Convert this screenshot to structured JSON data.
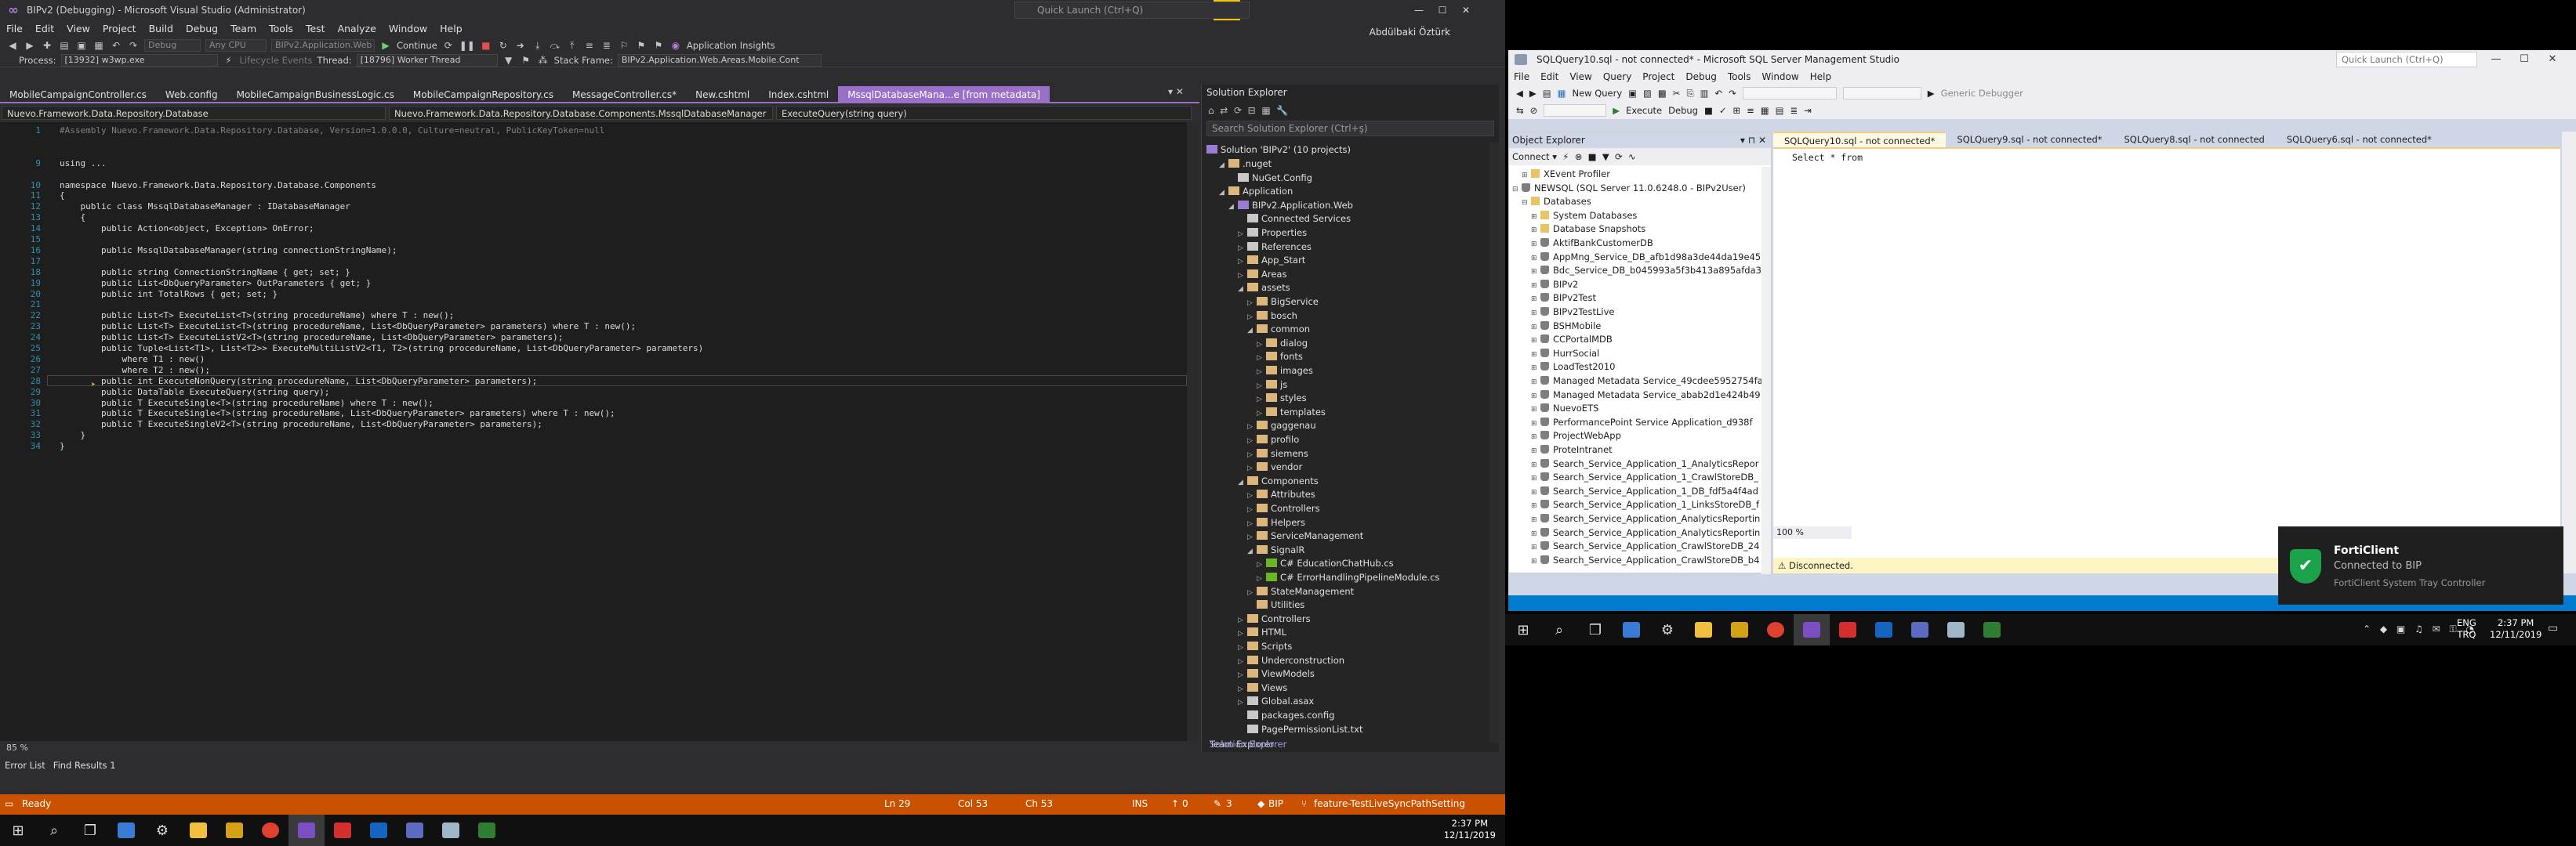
{
  "vs": {
    "title": "BIPv2 (Debugging) - Microsoft Visual Studio (Administrator)",
    "menu": [
      "File",
      "Edit",
      "View",
      "Project",
      "Build",
      "Debug",
      "Team",
      "Tools",
      "Test",
      "Analyze",
      "Window",
      "Help"
    ],
    "quick_launch": "Quick Launch (Ctrl+Q)",
    "user": "Abdülbaki Öztürk",
    "toolbar": {
      "debug_combo": "Debug",
      "cpu_combo": "Any CPU",
      "project_combo": "BIPv2.Application.Web",
      "continue": "Continue",
      "app_insights": "Application Insights",
      "process_label": "Process:",
      "process_value": "[13932] w3wp.exe",
      "lifecycle": "Lifecycle Events",
      "thread_label": "Thread:",
      "thread_value": "[18796] Worker Thread",
      "stack_label": "Stack Frame:",
      "stack_value": "BIPv2.Application.Web.Areas.Mobile.Cont"
    },
    "doc_tabs": [
      {
        "label": "MobileCampaignController.cs",
        "active": false
      },
      {
        "label": "Web.config",
        "active": false
      },
      {
        "label": "MobileCampaignBusinessLogic.cs",
        "active": false
      },
      {
        "label": "MobileCampaignRepository.cs",
        "active": false
      },
      {
        "label": "MessageController.cs*",
        "active": false
      },
      {
        "label": "New.cshtml",
        "active": false
      },
      {
        "label": "Index.cshtml",
        "active": false
      },
      {
        "label": "MssqlDatabaseMana...e [from metadata]",
        "active": true
      }
    ],
    "nav": {
      "left": "Nuevo.Framework.Data.Repository.Database",
      "middle": "Nuevo.Framework.Data.Repository.Database.Components.MssqlDatabaseManager",
      "right": "ExecuteQuery(string query)"
    },
    "code_lines": [
      {
        "n": "1",
        "t": "#Assembly Nuevo.Framework.Data.Repository.Database, Version=1.0.0.0, Culture=neutral, PublicKeyToken=null",
        "cls": "cm"
      },
      {
        "n": "",
        "t": "",
        "cls": ""
      },
      {
        "n": "",
        "t": "",
        "cls": ""
      },
      {
        "n": "9",
        "t": "using ...",
        "cls": ""
      },
      {
        "n": "",
        "t": "",
        "cls": ""
      },
      {
        "n": "10",
        "t": "namespace Nuevo.Framework.Data.Repository.Database.Components",
        "cls": ""
      },
      {
        "n": "11",
        "t": "{",
        "cls": ""
      },
      {
        "n": "12",
        "t": "    public class MssqlDatabaseManager : IDatabaseManager",
        "cls": ""
      },
      {
        "n": "13",
        "t": "    {",
        "cls": ""
      },
      {
        "n": "14",
        "t": "        public Action<object, Exception> OnError;",
        "cls": ""
      },
      {
        "n": "15",
        "t": "",
        "cls": ""
      },
      {
        "n": "16",
        "t": "        public MssqlDatabaseManager(string connectionStringName);",
        "cls": ""
      },
      {
        "n": "17",
        "t": "",
        "cls": ""
      },
      {
        "n": "18",
        "t": "        public string ConnectionStringName { get; set; }",
        "cls": ""
      },
      {
        "n": "19",
        "t": "        public List<DbQueryParameter> OutParameters { get; }",
        "cls": ""
      },
      {
        "n": "20",
        "t": "        public int TotalRows { get; set; }",
        "cls": ""
      },
      {
        "n": "21",
        "t": "",
        "cls": ""
      },
      {
        "n": "22",
        "t": "        public List<T> ExecuteList<T>(string procedureName) where T : new();",
        "cls": ""
      },
      {
        "n": "23",
        "t": "        public List<T> ExecuteList<T>(string procedureName, List<DbQueryParameter> parameters) where T : new();",
        "cls": ""
      },
      {
        "n": "24",
        "t": "        public List<T> ExecuteListV2<T>(string procedureName, List<DbQueryParameter> parameters);",
        "cls": ""
      },
      {
        "n": "25",
        "t": "        public Tuple<List<T1>, List<T2>> ExecuteMultiListV2<T1, T2>(string procedureName, List<DbQueryParameter> parameters)",
        "cls": ""
      },
      {
        "n": "26",
        "t": "            where T1 : new()",
        "cls": ""
      },
      {
        "n": "27",
        "t": "            where T2 : new();",
        "cls": ""
      },
      {
        "n": "28",
        "t": "        public int ExecuteNonQuery(string procedureName, List<DbQueryParameter> parameters);",
        "cls": ""
      },
      {
        "n": "29",
        "t": "        public DataTable ExecuteQuery(string query);",
        "cls": ""
      },
      {
        "n": "30",
        "t": "        public T ExecuteSingle<T>(string procedureName) where T : new();",
        "cls": ""
      },
      {
        "n": "31",
        "t": "        public T ExecuteSingle<T>(string procedureName, List<DbQueryParameter> parameters) where T : new();",
        "cls": ""
      },
      {
        "n": "32",
        "t": "        public T ExecuteSingleV2<T>(string procedureName, List<DbQueryParameter> parameters);",
        "cls": ""
      },
      {
        "n": "33",
        "t": "    }",
        "cls": ""
      },
      {
        "n": "34",
        "t": "}",
        "cls": ""
      }
    ],
    "zoom": "85 %",
    "bottom_tabs": [
      "Error List",
      "Find Results 1"
    ],
    "solution_explorer": {
      "title": "Solution Explorer",
      "search": "Search Solution Explorer (Ctrl+ş)",
      "bottom_tabs": [
        "Solution Explorer",
        "Team Explorer"
      ],
      "items": [
        {
          "label": "XEvent Profiler",
          "indent": 0,
          "kind": "file",
          "ex": ""
        },
        {
          "label": ".nuget",
          "indent": 1,
          "kind": "fold",
          "ex": "◢"
        },
        {
          "label": "NuGet.Config",
          "indent": 2,
          "kind": "file",
          "ex": ""
        },
        {
          "label": "Application",
          "indent": 1,
          "kind": "fold",
          "ex": "◢"
        },
        {
          "label": "BIPv2.Application.Web",
          "indent": 2,
          "kind": "prj",
          "ex": "◢"
        },
        {
          "label": "Connected Services",
          "indent": 3,
          "kind": "file",
          "ex": ""
        },
        {
          "label": "Properties",
          "indent": 3,
          "kind": "file",
          "ex": "▷"
        },
        {
          "label": "References",
          "indent": 3,
          "kind": "file",
          "ex": "▷"
        },
        {
          "label": "App_Start",
          "indent": 3,
          "kind": "fold",
          "ex": "▷"
        },
        {
          "label": "Areas",
          "indent": 3,
          "kind": "fold",
          "ex": "▷"
        },
        {
          "label": "assets",
          "indent": 3,
          "kind": "fold",
          "ex": "◢"
        },
        {
          "label": "BigService",
          "indent": 4,
          "kind": "fold",
          "ex": "▷"
        },
        {
          "label": "bosch",
          "indent": 4,
          "kind": "fold",
          "ex": "▷"
        },
        {
          "label": "common",
          "indent": 4,
          "kind": "fold",
          "ex": "◢"
        },
        {
          "label": "dialog",
          "indent": 5,
          "kind": "fold",
          "ex": "▷"
        },
        {
          "label": "fonts",
          "indent": 5,
          "kind": "fold",
          "ex": "▷"
        },
        {
          "label": "images",
          "indent": 5,
          "kind": "fold",
          "ex": "▷"
        },
        {
          "label": "js",
          "indent": 5,
          "kind": "fold",
          "ex": "▷"
        },
        {
          "label": "styles",
          "indent": 5,
          "kind": "fold",
          "ex": "▷"
        },
        {
          "label": "templates",
          "indent": 5,
          "kind": "fold",
          "ex": "▷"
        },
        {
          "label": "gaggenau",
          "indent": 4,
          "kind": "fold",
          "ex": "▷"
        },
        {
          "label": "profilo",
          "indent": 4,
          "kind": "fold",
          "ex": "▷"
        },
        {
          "label": "siemens",
          "indent": 4,
          "kind": "fold",
          "ex": "▷"
        },
        {
          "label": "vendor",
          "indent": 4,
          "kind": "fold",
          "ex": "▷"
        },
        {
          "label": "Components",
          "indent": 3,
          "kind": "fold",
          "ex": "◢"
        },
        {
          "label": "Attributes",
          "indent": 4,
          "kind": "fold",
          "ex": "▷"
        },
        {
          "label": "Controllers",
          "indent": 4,
          "kind": "fold",
          "ex": "▷"
        },
        {
          "label": "Helpers",
          "indent": 4,
          "kind": "fold",
          "ex": "▷"
        },
        {
          "label": "ServiceManagement",
          "indent": 4,
          "kind": "fold",
          "ex": "▷"
        },
        {
          "label": "SignalR",
          "indent": 4,
          "kind": "fold",
          "ex": "◢"
        },
        {
          "label": "C# EducationChatHub.cs",
          "indent": 5,
          "kind": "cs",
          "ex": "▷"
        },
        {
          "label": "C# ErrorHandlingPipelineModule.cs",
          "indent": 5,
          "kind": "cs",
          "ex": "▷"
        },
        {
          "label": "StateManagement",
          "indent": 4,
          "kind": "fold",
          "ex": "▷"
        },
        {
          "label": "Utilities",
          "indent": 4,
          "kind": "fold",
          "ex": ""
        },
        {
          "label": "Controllers",
          "indent": 3,
          "kind": "fold",
          "ex": "▷"
        },
        {
          "label": "HTML",
          "indent": 3,
          "kind": "fold",
          "ex": "▷"
        },
        {
          "label": "Scripts",
          "indent": 3,
          "kind": "fold",
          "ex": "▷"
        },
        {
          "label": "Underconstruction",
          "indent": 3,
          "kind": "fold",
          "ex": "▷"
        },
        {
          "label": "ViewModels",
          "indent": 3,
          "kind": "fold",
          "ex": "▷"
        },
        {
          "label": "Views",
          "indent": 3,
          "kind": "fold",
          "ex": "▷"
        },
        {
          "label": "Global.asax",
          "indent": 3,
          "kind": "file",
          "ex": "▷"
        },
        {
          "label": "packages.config",
          "indent": 3,
          "kind": "file",
          "ex": ""
        },
        {
          "label": "PagePermissionList.txt",
          "indent": 3,
          "kind": "file",
          "ex": ""
        }
      ]
    },
    "solution_root": "Solution 'BIPv2' (10 projects)",
    "status": {
      "ready": "Ready",
      "ln": "Ln 29",
      "col": "Col 53",
      "ch": "Ch 53",
      "ins": "INS",
      "up": "0",
      "pencil": "3",
      "repo": "BIP",
      "branch": "feature-TestLiveSyncPathSetting"
    },
    "clock": {
      "time": "2:37 PM",
      "date": "12/11/2019"
    }
  },
  "ssms": {
    "title": "SQLQuery10.sql - not connected* - Microsoft SQL Server Management Studio",
    "quick_launch": "Quick Launch (Ctrl+Q)",
    "menu": [
      "File",
      "Edit",
      "View",
      "Query",
      "Project",
      "Debug",
      "Tools",
      "Window",
      "Help"
    ],
    "new_query": "New Query",
    "execute": "Execute",
    "debug": "Debug",
    "generic_debugger": "Generic Debugger",
    "object_explorer": {
      "title": "Object Explorer",
      "connect": "Connect",
      "items": [
        {
          "label": "XEvent Profiler",
          "indent": 1,
          "kind": "fo",
          "ex": "⊞"
        },
        {
          "label": "NEWSQL (SQL Server 11.0.6248.0 - BIPv2User)",
          "indent": 0,
          "kind": "db",
          "ex": "⊟"
        },
        {
          "label": "Databases",
          "indent": 1,
          "kind": "fo",
          "ex": "⊟"
        },
        {
          "label": "System Databases",
          "indent": 2,
          "kind": "fo",
          "ex": "⊞"
        },
        {
          "label": "Database Snapshots",
          "indent": 2,
          "kind": "fo",
          "ex": "⊞"
        },
        {
          "label": "AktifBankCustomerDB",
          "indent": 2,
          "kind": "db",
          "ex": "⊞"
        },
        {
          "label": "AppMng_Service_DB_afb1d98a3de44da19e45",
          "indent": 2,
          "kind": "db",
          "ex": "⊞"
        },
        {
          "label": "Bdc_Service_DB_b045993a5f3b413a895afda3a",
          "indent": 2,
          "kind": "db",
          "ex": "⊞"
        },
        {
          "label": "BIPv2",
          "indent": 2,
          "kind": "db",
          "ex": "⊞"
        },
        {
          "label": "BIPv2Test",
          "indent": 2,
          "kind": "db",
          "ex": "⊞"
        },
        {
          "label": "BIPv2TestLive",
          "indent": 2,
          "kind": "db",
          "ex": "⊞"
        },
        {
          "label": "BSHMobile",
          "indent": 2,
          "kind": "db",
          "ex": "⊞"
        },
        {
          "label": "CCPortalMDB",
          "indent": 2,
          "kind": "db",
          "ex": "⊞"
        },
        {
          "label": "HurrSocial",
          "indent": 2,
          "kind": "db",
          "ex": "⊞"
        },
        {
          "label": "LoadTest2010",
          "indent": 2,
          "kind": "db",
          "ex": "⊞"
        },
        {
          "label": "Managed Metadata Service_49cdee5952754fa",
          "indent": 2,
          "kind": "db",
          "ex": "⊞"
        },
        {
          "label": "Managed Metadata Service_abab2d1e424b49",
          "indent": 2,
          "kind": "db",
          "ex": "⊞"
        },
        {
          "label": "NuevoETS",
          "indent": 2,
          "kind": "db",
          "ex": "⊞"
        },
        {
          "label": "PerformancePoint Service Application_d938f",
          "indent": 2,
          "kind": "db",
          "ex": "⊞"
        },
        {
          "label": "ProjectWebApp",
          "indent": 2,
          "kind": "db",
          "ex": "⊞"
        },
        {
          "label": "ProteIntranet",
          "indent": 2,
          "kind": "db",
          "ex": "⊞"
        },
        {
          "label": "Search_Service_Application_1_AnalyticsRepor",
          "indent": 2,
          "kind": "db",
          "ex": "⊞"
        },
        {
          "label": "Search_Service_Application_1_CrawlStoreDB_",
          "indent": 2,
          "kind": "db",
          "ex": "⊞"
        },
        {
          "label": "Search_Service_Application_1_DB_fdf5a4f4ad",
          "indent": 2,
          "kind": "db",
          "ex": "⊞"
        },
        {
          "label": "Search_Service_Application_1_LinksStoreDB_f",
          "indent": 2,
          "kind": "db",
          "ex": "⊞"
        },
        {
          "label": "Search_Service_Application_AnalyticsReportin",
          "indent": 2,
          "kind": "db",
          "ex": "⊞"
        },
        {
          "label": "Search_Service_Application_AnalyticsReportin",
          "indent": 2,
          "kind": "db",
          "ex": "⊞"
        },
        {
          "label": "Search_Service_Application_CrawlStoreDB_24",
          "indent": 2,
          "kind": "db",
          "ex": "⊞"
        },
        {
          "label": "Search_Service_Application_CrawlStoreDB_b4",
          "indent": 2,
          "kind": "db",
          "ex": "⊞"
        }
      ]
    },
    "doc_tabs": [
      {
        "label": "SQLQuery10.sql - not connected*",
        "active": true
      },
      {
        "label": "SQLQuery9.sql - not connected*",
        "active": false
      },
      {
        "label": "SQLQuery8.sql - not connected",
        "active": false
      },
      {
        "label": "SQLQuery6.sql - not connected*",
        "active": false
      }
    ],
    "query": "Select * from",
    "zoom": "100 %",
    "message": "Disconnected."
  },
  "toast": {
    "title": "FortiClient",
    "subtitle": "Connected to BIP",
    "app": "FortiClient System Tray Controller"
  },
  "taskbar_right": {
    "lang": "ENG",
    "region": "TRQ",
    "time": "2:37 PM",
    "date": "12/11/2019"
  },
  "colors": {
    "vs_accent": "#9a6fc7",
    "vs_status": "#ca5100",
    "ssms_status": "#007acc",
    "toast_icon": "#1aa34a"
  }
}
